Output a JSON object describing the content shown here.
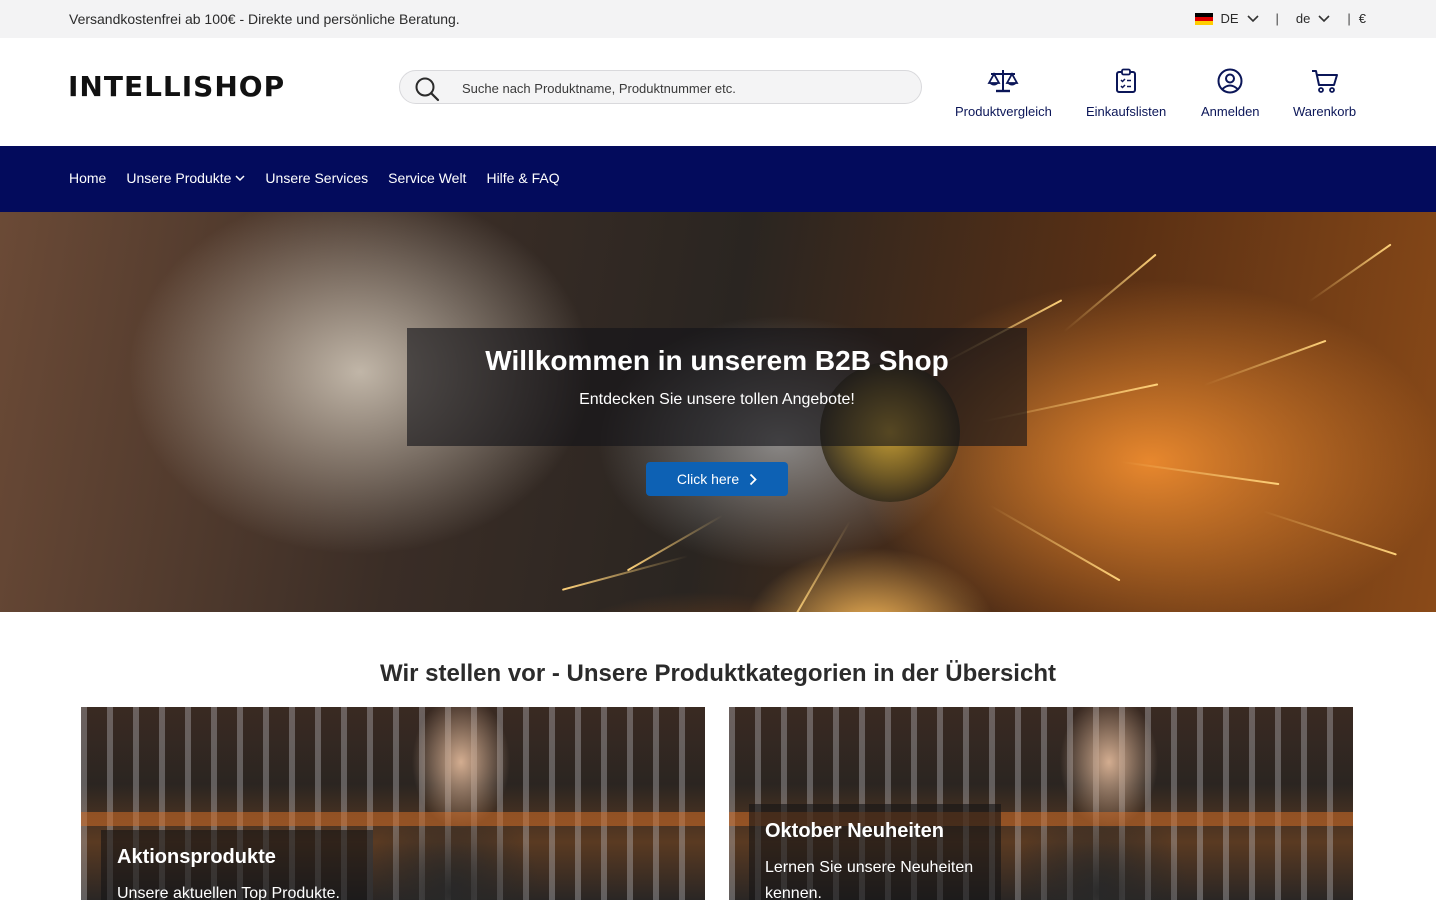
{
  "topbar": {
    "info": "Versandkostenfrei ab 100€ - Direkte und persönliche Beratung.",
    "country": "DE",
    "language": "de",
    "currency": "€",
    "separator": "|"
  },
  "header": {
    "logo": "INTELLISHOP",
    "search": {
      "placeholder": "Suche nach Produktname, Produktnummer etc."
    },
    "actions": [
      {
        "label": "Produktvergleich",
        "icon": "scale-icon"
      },
      {
        "label": "Einkaufslisten",
        "icon": "clipboard-list-icon"
      },
      {
        "label": "Anmelden",
        "icon": "user-circle-icon"
      },
      {
        "label": "Warenkorb",
        "icon": "cart-icon"
      }
    ]
  },
  "nav": {
    "items": [
      {
        "label": "Home"
      },
      {
        "label": "Unsere Produkte",
        "has_dropdown": true
      },
      {
        "label": "Unsere Services"
      },
      {
        "label": "Service Welt"
      },
      {
        "label": "Hilfe & FAQ"
      }
    ]
  },
  "hero": {
    "title": "Willkommen in unserem B2B Shop",
    "subtitle": "Entdecken Sie unsere tollen Angebote!",
    "button_label": "Click here"
  },
  "categories": {
    "title": "Wir stellen vor - Unsere Produktkategorien in der Übersicht",
    "cards": [
      {
        "title": "Aktionsprodukte",
        "text": "Unsere aktuellen Top Produkte."
      },
      {
        "title": "Oktober Neuheiten",
        "text": "Lernen Sie unsere Neuheiten kennen."
      }
    ]
  },
  "colors": {
    "nav_background": "#030b5c",
    "accent": "#0d61b4",
    "header_icon": "#0b1658"
  }
}
